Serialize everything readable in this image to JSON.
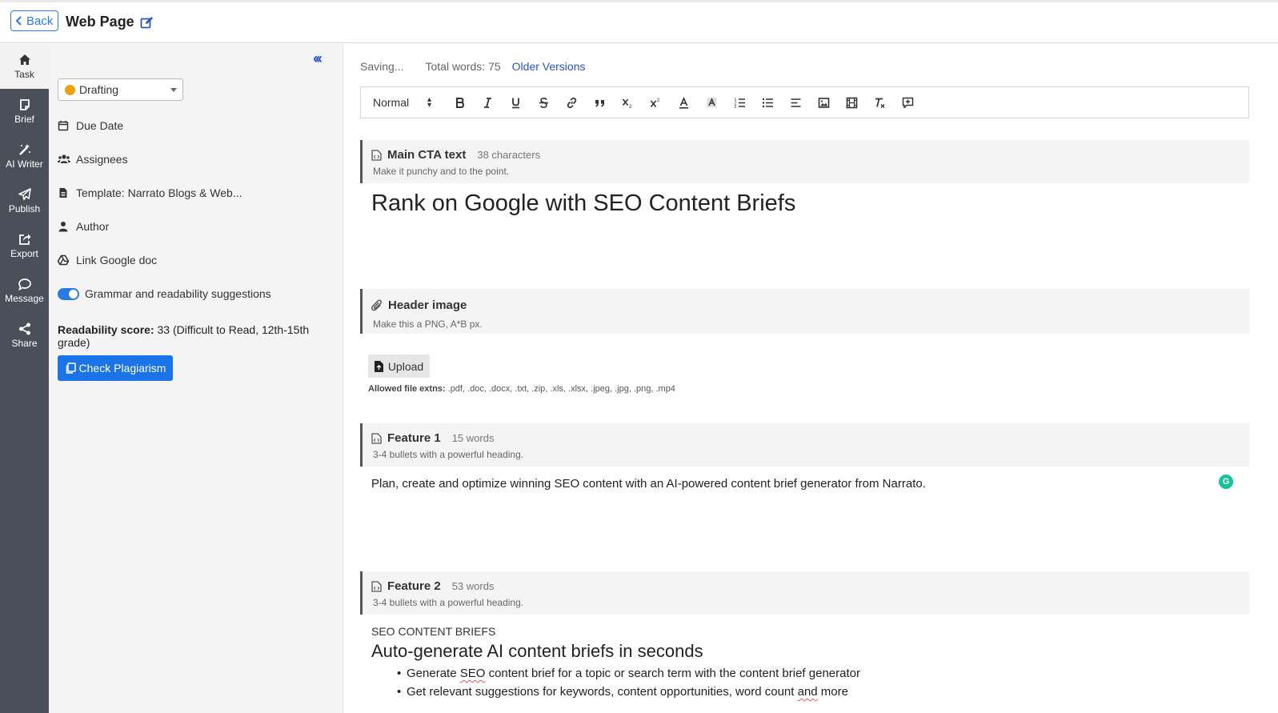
{
  "header": {
    "back_label": "Back",
    "title": "Web Page"
  },
  "rail": {
    "items": [
      {
        "label": "Task",
        "icon": "home-icon"
      },
      {
        "label": "Brief",
        "icon": "note-icon"
      },
      {
        "label": "AI Writer",
        "icon": "magic-wand-icon"
      },
      {
        "label": "Publish",
        "icon": "paper-plane-icon"
      },
      {
        "label": "Export",
        "icon": "share-square-icon"
      },
      {
        "label": "Message",
        "icon": "chat-bubble-icon"
      },
      {
        "label": "Share",
        "icon": "share-nodes-icon"
      }
    ]
  },
  "sidebar": {
    "collapse_glyph": "‹‹‹",
    "status": "Drafting",
    "status_color": "#f0a00c",
    "due_date": "Due Date",
    "assignees": "Assignees",
    "template": "Template: Narrato Blogs & Web...",
    "author": "Author",
    "link_google_doc": "Link Google doc",
    "grammar_toggle_label": "Grammar and readability suggestions",
    "grammar_enabled": true,
    "readability_label": "Readability score:",
    "readability_value": "33 (Difficult to Read, 12th-15th grade)",
    "check_plagiarism": "Check Plagiarism"
  },
  "editor": {
    "saving": "Saving...",
    "total_words": "Total words: 75",
    "older_versions": "Older Versions",
    "toolbar": {
      "format": "Normal",
      "buttons": [
        "bold",
        "italic",
        "underline",
        "strike",
        "link",
        "blockquote",
        "subscript",
        "superscript",
        "text-color",
        "background-color",
        "ordered-list",
        "bullet-list",
        "align",
        "image",
        "video",
        "clear-format",
        "comment"
      ]
    }
  },
  "sections": {
    "cta": {
      "title": "Main CTA text",
      "count": "38 characters",
      "hint": "Make it punchy and to the point.",
      "content": "Rank on Google with SEO Content Briefs"
    },
    "header_image": {
      "title": "Header image",
      "hint": "Make this a PNG, A*B px.",
      "upload": "Upload",
      "allowed_label": "Allowed file extns:",
      "allowed_value": " .pdf, .doc, .docx, .txt, .zip, .xls, .xlsx, .jpeg, .jpg, .png, .mp4"
    },
    "feature1": {
      "title": "Feature 1",
      "count": "15 words",
      "hint": "3-4 bullets with a powerful heading.",
      "content": "Plan, create and optimize winning SEO content with an AI-powered content brief generator from Narrato."
    },
    "feature2": {
      "title": "Feature 2",
      "count": "53 words",
      "hint": "3-4 bullets with a powerful heading.",
      "eyebrow": "SEO CONTENT BRIEFS",
      "heading": "Auto-generate AI content briefs in seconds",
      "bullet1_a": "Generate ",
      "bullet1_b": "SEO",
      "bullet1_c": " content brief for a topic or search term with the content brief generator",
      "bullet2_a": "Get relevant suggestions for keywords, content opportunities, word count ",
      "bullet2_b": "and",
      "bullet2_c": " more"
    }
  },
  "grammarly_glyph": "G"
}
